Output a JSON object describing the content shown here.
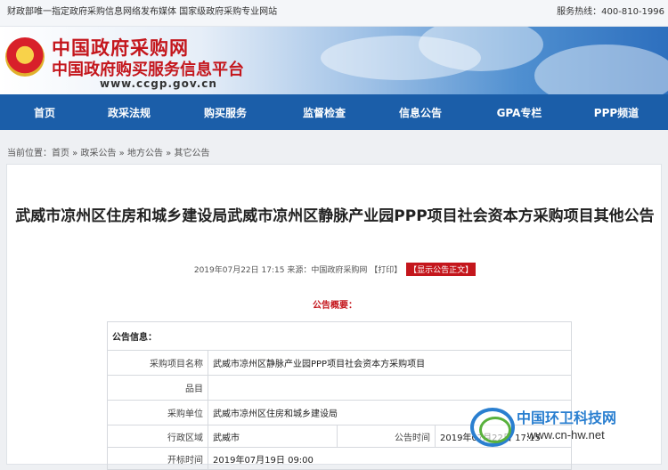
{
  "topbar": {
    "tagline": "财政部唯一指定政府采购信息网络发布媒体 国家级政府采购专业网站",
    "hotline": "服务热线：400-810-1996"
  },
  "header": {
    "title": "中国政府采购网",
    "subtitle": "中国政府购买服务信息平台",
    "url": "www.ccgp.gov.cn"
  },
  "nav": {
    "items": [
      "首页",
      "政采法规",
      "购买服务",
      "监督检查",
      "信息公告",
      "GPA专栏",
      "PPP频道"
    ]
  },
  "breadcrumb": {
    "prefix": "当前位置：",
    "items": [
      "首页",
      "政采公告",
      "地方公告",
      "其它公告"
    ],
    "sep": " » "
  },
  "article": {
    "title": "武威市凉州区住房和城乡建设局武威市凉州区静脉产业园PPP项目社会资本方采购项目其他公告",
    "datetime": "2019年07月22日 17:15",
    "source_label": "来源：",
    "source": "中国政府采购网",
    "print": "【打印】",
    "show_body": "【显示公告正文】",
    "summary_label": "公告概要："
  },
  "info": {
    "header": "公告信息：",
    "rows": {
      "project_name_key": "采购项目名称",
      "project_name_val": "武威市凉州区静脉产业园PPP项目社会资本方采购项目",
      "item_key": "品目",
      "item_val": "",
      "unit_key": "采购单位",
      "unit_val": "武威市凉州区住房和城乡建设局",
      "region_key": "行政区域",
      "region_val": "武威市",
      "pubtime_key": "公告时间",
      "pubtime_val": "2019年07月22日 17:15",
      "bidopen_key": "开标时间",
      "bidopen_val": "2019年07月19日 09:00"
    }
  },
  "watermark": {
    "title": "中国环卫科技网",
    "url": "www.cn-hw.net"
  },
  "colors": {
    "nav_bg": "#1b5ea9",
    "brand_red": "#c4161c"
  }
}
